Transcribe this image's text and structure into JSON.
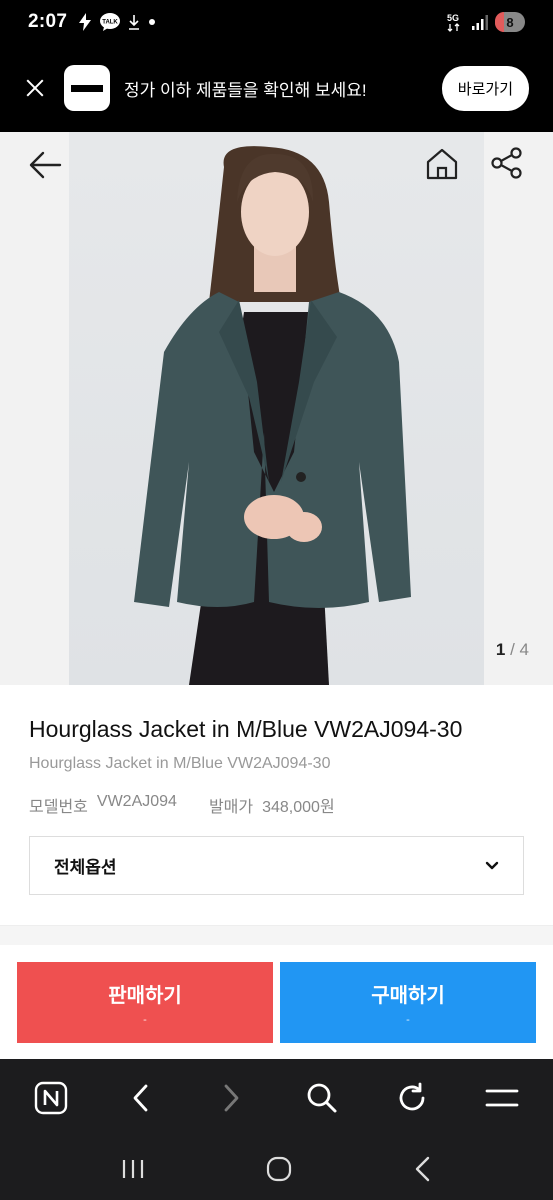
{
  "status_bar": {
    "time": "2:07",
    "talk_badge": "TALK",
    "network": "5G",
    "battery": "8"
  },
  "banner": {
    "text": "정가 이하 제품들을 확인해 보세요!",
    "button_label": "바로가기"
  },
  "gallery": {
    "current_page": "1",
    "separator": " / ",
    "total_pages": "4"
  },
  "product": {
    "title": "Hourglass Jacket in M/Blue VW2AJ094-30",
    "subtitle": "Hourglass Jacket in M/Blue VW2AJ094-30",
    "model_label": "모델번호",
    "model_value": "VW2AJ094",
    "price_label": "발매가",
    "price_value": "348,000원"
  },
  "options": {
    "label": "전체옵션"
  },
  "actions": {
    "sell_label": "판매하기",
    "sell_sub": "-",
    "buy_label": "구매하기",
    "buy_sub": "-"
  },
  "colors": {
    "sell": "#ef5050",
    "buy": "#2196f3",
    "jacket": "#3f5558"
  }
}
